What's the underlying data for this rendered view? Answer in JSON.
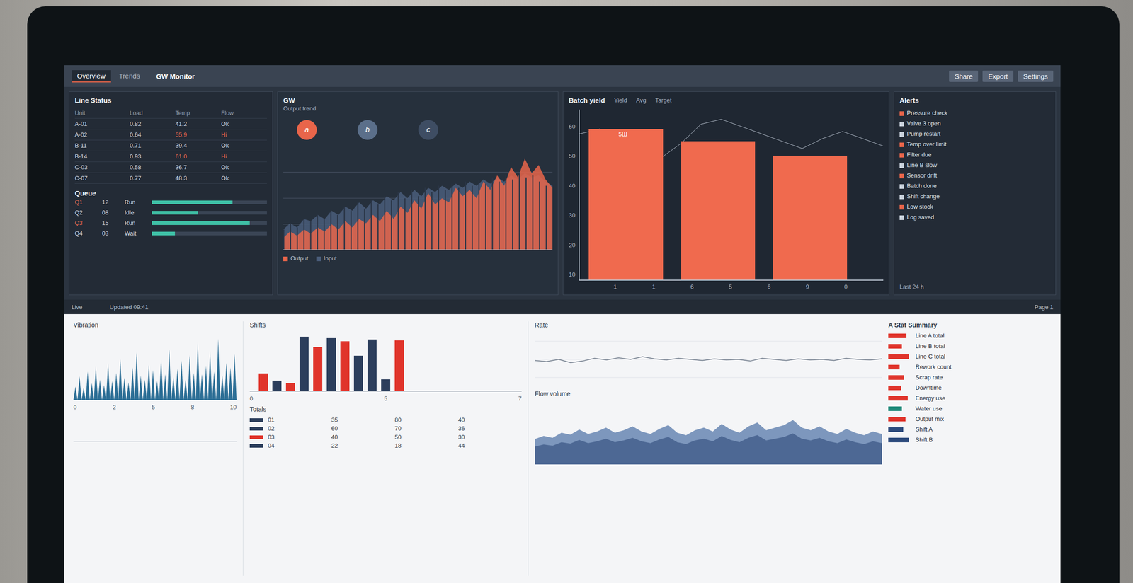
{
  "toolbar": {
    "tabs": [
      {
        "label": "Overview",
        "selected": true
      },
      {
        "label": "Trends",
        "selected": false
      }
    ],
    "title": "GW Monitor",
    "actions": [
      "Share",
      "Export",
      "Settings"
    ]
  },
  "table_panel": {
    "title": "Line Status",
    "columns": [
      "Unit",
      "Load",
      "Temp",
      "Flow"
    ],
    "rows": [
      {
        "cells": [
          "A-01",
          "0.82",
          "41.2",
          "Ok"
        ],
        "alert": false
      },
      {
        "cells": [
          "A-02",
          "0.64",
          "55.9",
          "Hi"
        ],
        "alert": true
      },
      {
        "cells": [
          "B-11",
          "0.71",
          "39.4",
          "Ok"
        ],
        "alert": false
      },
      {
        "cells": [
          "B-14",
          "0.93",
          "61.0",
          "Hi"
        ],
        "alert": true
      },
      {
        "cells": [
          "C-03",
          "0.58",
          "36.7",
          "Ok"
        ],
        "alert": false
      },
      {
        "cells": [
          "C-07",
          "0.77",
          "48.3",
          "Ok"
        ],
        "alert": false
      }
    ],
    "sub_title": "Queue",
    "sub_rows": [
      {
        "cells": [
          "Q1",
          "12",
          "Run"
        ],
        "alert": true,
        "level": 0.7
      },
      {
        "cells": [
          "Q2",
          "08",
          "Idle"
        ],
        "alert": false,
        "level": 0.4
      },
      {
        "cells": [
          "Q3",
          "15",
          "Run"
        ],
        "alert": true,
        "level": 0.85
      },
      {
        "cells": [
          "Q4",
          "03",
          "Wait"
        ],
        "alert": false,
        "level": 0.2
      }
    ]
  },
  "area_panel": {
    "title": "GW",
    "subtitle": "Output trend",
    "bubbles": [
      {
        "label": "a",
        "color": "#e8654a"
      },
      {
        "label": "b",
        "color": "#5b6f8a"
      },
      {
        "label": "c",
        "color": "#3e4d63"
      }
    ],
    "max": 100,
    "series": [
      {
        "name": "Output",
        "color": "#e8654a",
        "values": [
          12,
          18,
          14,
          20,
          16,
          22,
          18,
          25,
          20,
          28,
          22,
          30,
          26,
          34,
          28,
          38,
          30,
          42,
          36,
          48,
          40,
          55,
          44,
          50,
          46,
          60,
          52,
          58,
          50,
          66,
          58,
          72,
          62,
          80,
          70,
          88,
          74,
          82,
          68,
          60
        ]
      },
      {
        "name": "Input",
        "color": "#4a5d7a",
        "values": [
          20,
          26,
          22,
          30,
          28,
          34,
          30,
          38,
          34,
          42,
          38,
          46,
          40,
          48,
          44,
          52,
          48,
          56,
          50,
          58,
          52,
          60,
          56,
          62,
          58,
          64,
          60,
          66,
          62,
          68,
          64,
          70,
          66,
          72,
          68,
          74,
          70,
          72,
          66,
          62
        ]
      }
    ]
  },
  "bar_panel": {
    "title": "Batch yield",
    "legend": [
      "Yield",
      "Avg",
      "Target"
    ],
    "y_ticks": [
      "60",
      "50",
      "40",
      "30",
      "20",
      "10"
    ],
    "x_ticks": [
      "1",
      "1",
      "6",
      "5",
      "6",
      "9",
      "0"
    ],
    "max": 70,
    "bars": [
      {
        "label": "5Ш",
        "value": 62
      },
      {
        "label": "",
        "value": 57
      },
      {
        "label": "",
        "value": 51
      }
    ],
    "line": [
      60,
      62,
      58,
      54,
      50,
      56,
      64,
      66,
      63,
      60,
      57,
      54,
      58,
      61,
      58,
      55
    ]
  },
  "list_panel": {
    "title": "Alerts",
    "items": [
      {
        "text": "Pressure check",
        "color": "#e8654a"
      },
      {
        "text": "Valve 3 open",
        "color": "#c9d2dc"
      },
      {
        "text": "Pump restart",
        "color": "#c9d2dc"
      },
      {
        "text": "Temp over limit",
        "color": "#e8654a"
      },
      {
        "text": "Filter due",
        "color": "#e8654a"
      },
      {
        "text": "Line B slow",
        "color": "#c9d2dc"
      },
      {
        "text": "Sensor drift",
        "color": "#e8654a"
      },
      {
        "text": "Batch done",
        "color": "#c9d2dc"
      },
      {
        "text": "Shift change",
        "color": "#c9d2dc"
      },
      {
        "text": "Low stock",
        "color": "#e8654a"
      },
      {
        "text": "Log saved",
        "color": "#c9d2dc"
      }
    ],
    "footer": "Last 24 h"
  },
  "status": {
    "left": "Live",
    "middle": "Updated 09:41",
    "right": "Page 1"
  },
  "spike_chart": {
    "title": "Vibration",
    "max": 100,
    "values": [
      20,
      35,
      18,
      42,
      25,
      50,
      30,
      22,
      55,
      28,
      40,
      60,
      33,
      26,
      48,
      70,
      36,
      30,
      52,
      44,
      28,
      62,
      38,
      75,
      34,
      46,
      58,
      30,
      66,
      40,
      85,
      38,
      50,
      72,
      42,
      90,
      36,
      55,
      48,
      68
    ],
    "x_ticks": [
      "0",
      "2",
      "5",
      "8",
      "10"
    ]
  },
  "mix_chart": {
    "title": "Shifts",
    "max": 100,
    "bars": [
      {
        "value": 30,
        "color": "#e0342b"
      },
      {
        "value": 18,
        "color": "#2c3e5c"
      },
      {
        "value": 14,
        "color": "#e0342b"
      },
      {
        "value": 92,
        "color": "#2c3e5c"
      },
      {
        "value": 75,
        "color": "#e0342b"
      },
      {
        "value": 90,
        "color": "#2c3e5c"
      },
      {
        "value": 85,
        "color": "#e0342b"
      },
      {
        "value": 60,
        "color": "#2c3e5c"
      },
      {
        "value": 88,
        "color": "#2c3e5c"
      },
      {
        "value": 20,
        "color": "#2c3e5c"
      },
      {
        "value": 86,
        "color": "#e0342b"
      }
    ],
    "x_ticks": [
      "0",
      "5",
      "7"
    ]
  },
  "mini_table": {
    "title": "Totals",
    "rows": [
      {
        "cells": [
          "01",
          "35",
          "80",
          "40"
        ],
        "color": "#2c3e5c"
      },
      {
        "cells": [
          "02",
          "60",
          "70",
          "36"
        ],
        "color": "#2c3e5c"
      },
      {
        "cells": [
          "03",
          "40",
          "50",
          "30"
        ],
        "color": "#e0342b"
      },
      {
        "cells": [
          "04",
          "22",
          "18",
          "44"
        ],
        "color": "#2c3e5c"
      }
    ]
  },
  "line_chart": {
    "title": "Rate",
    "max": 100,
    "values": [
      48,
      46,
      50,
      44,
      47,
      52,
      49,
      53,
      50,
      55,
      51,
      49,
      52,
      50,
      48,
      51,
      49,
      50,
      47,
      52,
      50,
      48,
      51,
      49,
      50,
      48,
      52,
      50,
      49,
      51
    ]
  },
  "area_chart": {
    "title": "Flow volume",
    "max": 100,
    "values": [
      40,
      45,
      42,
      50,
      47,
      55,
      48,
      52,
      58,
      50,
      54,
      60,
      52,
      48,
      56,
      62,
      50,
      46,
      54,
      58,
      52,
      64,
      55,
      50,
      60,
      66,
      54,
      58,
      62,
      70,
      58,
      54,
      60,
      52,
      48,
      56,
      50,
      46,
      52,
      48
    ]
  },
  "legend_panel": {
    "title": "A Stat Summary",
    "items": [
      {
        "text": "Line A total",
        "color": "#e0342b",
        "level": 0.8
      },
      {
        "text": "Line B total",
        "color": "#e0342b",
        "level": 0.6
      },
      {
        "text": "Line C total",
        "color": "#e0342b",
        "level": 0.9
      },
      {
        "text": "Rework count",
        "color": "#e0342b",
        "level": 0.5
      },
      {
        "text": "Scrap rate",
        "color": "#e0342b",
        "level": 0.7
      },
      {
        "text": "Downtime",
        "color": "#e0342b",
        "level": 0.55
      },
      {
        "text": "Energy use",
        "color": "#e0342b",
        "level": 0.85
      },
      {
        "text": "Water use",
        "color": "#1f8a7a",
        "level": 0.6
      },
      {
        "text": "Output mix",
        "color": "#e0342b",
        "level": 0.75
      },
      {
        "text": "Shift A",
        "color": "#2c4a7c",
        "level": 0.65
      },
      {
        "text": "Shift B",
        "color": "#2c4a7c",
        "level": 0.9
      }
    ]
  }
}
